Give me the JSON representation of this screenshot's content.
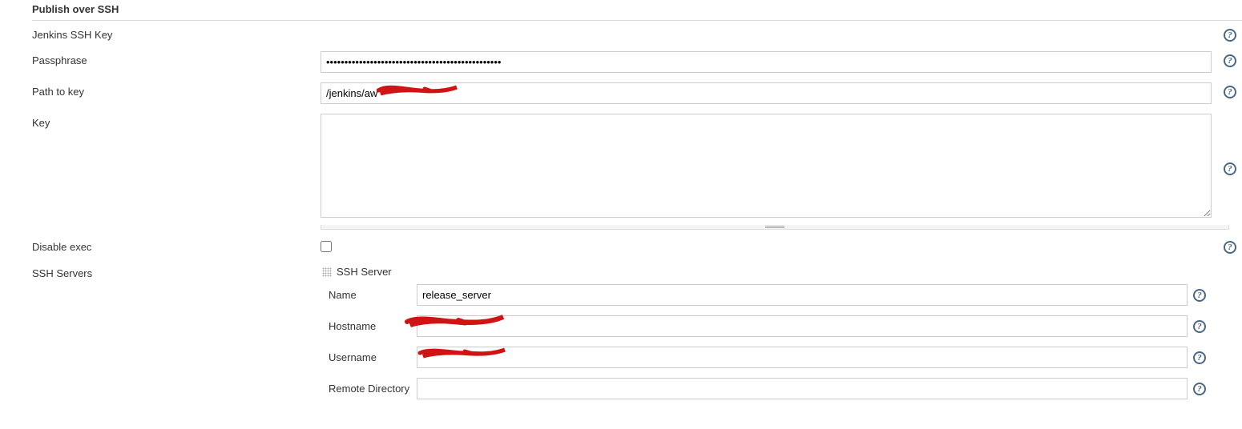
{
  "section": {
    "title": "Publish over SSH"
  },
  "labels": {
    "jenkins_ssh_key": "Jenkins SSH Key",
    "passphrase": "Passphrase",
    "path_to_key": "Path to key",
    "key": "Key",
    "disable_exec": "Disable exec",
    "ssh_servers": "SSH Servers"
  },
  "fields": {
    "passphrase_value": "••••••••••••••••••••••••••••••••••••••••••••••••",
    "path_to_key_value": "/jenkins/aw",
    "key_value": "",
    "disable_exec_checked": false
  },
  "ssh_server": {
    "header": "SSH Server",
    "name_label": "Name",
    "name_value": "release_server",
    "hostname_label": "Hostname",
    "hostname_value": "",
    "username_label": "Username",
    "username_value": "",
    "remote_dir_label": "Remote Directory",
    "remote_dir_value": ""
  },
  "help_glyph": "?"
}
